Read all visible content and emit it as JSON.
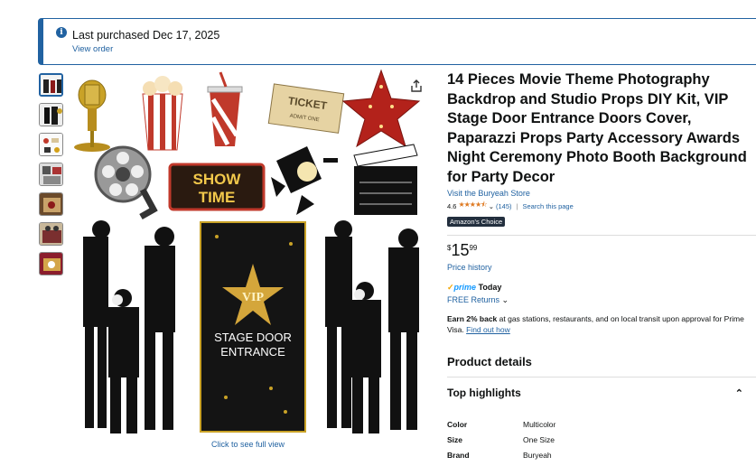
{
  "banner": {
    "text": "Last purchased Dec 17, 2025",
    "link": "View order",
    "icon": "info-icon"
  },
  "gallery": {
    "caption": "Click to see full view",
    "sign_show": "SHOW",
    "sign_time": "TIME",
    "ticket": "TICKET",
    "ticket_sub": "ADMIT ONE",
    "door_vip": "VIP",
    "door_line1": "STAGE DOOR",
    "door_line2": "ENTRANCE",
    "share_icon": "share-icon"
  },
  "product": {
    "title": "14 Pieces Movie Theme Photography Backdrop and Studio Props DIY Kit, VIP Stage Door Entrance Doors Cover, Paparazzi Props Party Accessory Awards Night Ceremony Photo Booth Background for Party Decor",
    "store": "Visit the Buryeah Store",
    "rating": "4.6",
    "stars": "★★★★⯪",
    "rating_count": "(145)",
    "search": "Search this page",
    "badge": "Amazon's Choice",
    "price_symbol": "$",
    "price_whole": "15",
    "price_fraction": "99",
    "price_history": "Price history",
    "prime": "prime",
    "prime_day": "Today",
    "returns": "FREE Returns",
    "earn_bold": "Earn 2% back",
    "earn_rest": " at gas stations, restaurants, and on local transit upon approval for Prime Visa. ",
    "earn_link": "Find out how"
  },
  "details": {
    "heading": "Product details",
    "highlights": "Top highlights",
    "specs": [
      {
        "k": "Color",
        "v": "Multicolor"
      },
      {
        "k": "Size",
        "v": "One Size"
      },
      {
        "k": "Brand",
        "v": "Buryeah"
      }
    ]
  }
}
